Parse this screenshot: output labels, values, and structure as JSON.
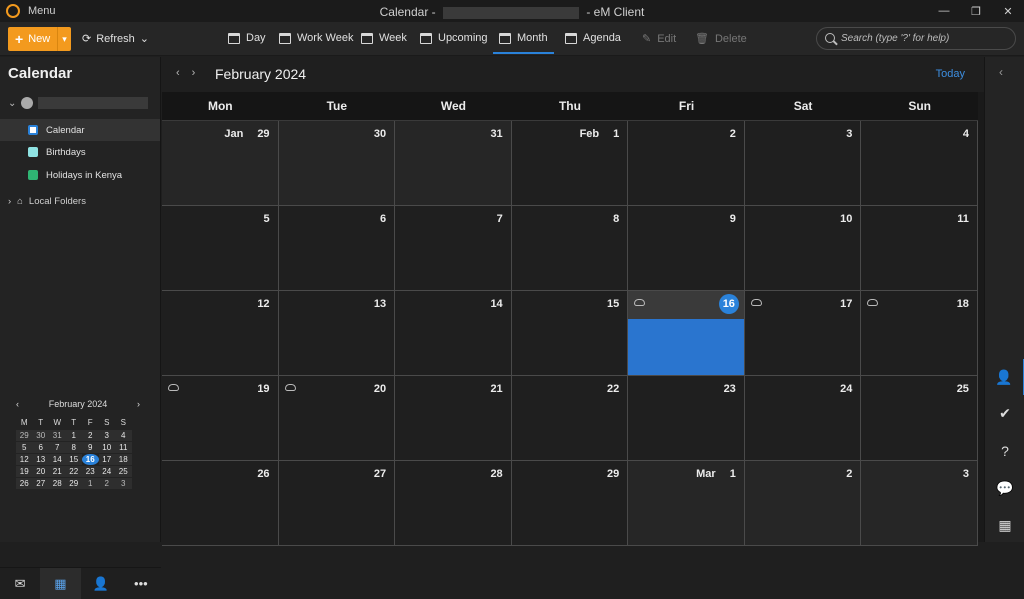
{
  "titlebar": {
    "menu_label": "Menu",
    "title_prefix": "Calendar -",
    "title_suffix": "- eM Client",
    "controls": [
      "—",
      "❐",
      "✕"
    ]
  },
  "toolbar": {
    "new_label": "New",
    "refresh_label": "Refresh",
    "views": [
      {
        "label": "Day"
      },
      {
        "label": "Work Week"
      },
      {
        "label": "Week"
      },
      {
        "label": "Upcoming"
      },
      {
        "label": "Month",
        "active": true
      },
      {
        "label": "Agenda"
      }
    ],
    "edit_label": "Edit",
    "delete_label": "Delete",
    "search_placeholder": "Search (type '?' for help)"
  },
  "sidebar": {
    "title": "Calendar",
    "calendars": [
      {
        "label": "Calendar",
        "color": "#ffffff",
        "selected": true
      },
      {
        "label": "Birthdays",
        "color": "#8fe3e3"
      },
      {
        "label": "Holidays in Kenya",
        "color": "#2fb573"
      }
    ],
    "local_folders_label": "Local Folders"
  },
  "mini_calendar": {
    "title": "February 2024",
    "day_headers": [
      "M",
      "T",
      "W",
      "T",
      "F",
      "S",
      "S"
    ],
    "days": [
      [
        "29",
        "30",
        "31",
        "1",
        "2",
        "3",
        "4"
      ],
      [
        "5",
        "6",
        "7",
        "8",
        "9",
        "10",
        "11"
      ],
      [
        "12",
        "13",
        "14",
        "15",
        "16",
        "17",
        "18"
      ],
      [
        "19",
        "20",
        "21",
        "22",
        "23",
        "24",
        "25"
      ],
      [
        "26",
        "27",
        "28",
        "29",
        "1",
        "2",
        "3"
      ]
    ],
    "today": "16"
  },
  "main": {
    "month_title": "February 2024",
    "today_label": "Today",
    "day_names": [
      "Mon",
      "Tue",
      "Wed",
      "Thu",
      "Fri",
      "Sat",
      "Sun"
    ],
    "weeks": [
      [
        {
          "d": "29",
          "m": "Jan",
          "other": true
        },
        {
          "d": "30",
          "other": true
        },
        {
          "d": "31",
          "other": true
        },
        {
          "d": "1",
          "m": "Feb"
        },
        {
          "d": "2"
        },
        {
          "d": "3"
        },
        {
          "d": "4"
        }
      ],
      [
        {
          "d": "5"
        },
        {
          "d": "6"
        },
        {
          "d": "7"
        },
        {
          "d": "8"
        },
        {
          "d": "9"
        },
        {
          "d": "10"
        },
        {
          "d": "11"
        }
      ],
      [
        {
          "d": "12"
        },
        {
          "d": "13"
        },
        {
          "d": "14"
        },
        {
          "d": "15"
        },
        {
          "d": "16",
          "today": true,
          "weather": true
        },
        {
          "d": "17",
          "weather": true
        },
        {
          "d": "18",
          "weather": true
        }
      ],
      [
        {
          "d": "19",
          "weather": true
        },
        {
          "d": "20",
          "weather": true
        },
        {
          "d": "21"
        },
        {
          "d": "22"
        },
        {
          "d": "23"
        },
        {
          "d": "24"
        },
        {
          "d": "25"
        }
      ],
      [
        {
          "d": "26"
        },
        {
          "d": "27"
        },
        {
          "d": "28"
        },
        {
          "d": "29"
        },
        {
          "d": "1",
          "m": "Mar",
          "other": true
        },
        {
          "d": "2",
          "other": true
        },
        {
          "d": "3",
          "other": true
        }
      ]
    ]
  },
  "bottom_nav": [
    {
      "icon": "mail-icon",
      "glyph": "✉"
    },
    {
      "icon": "calendar-icon",
      "glyph": "▦",
      "active": true
    },
    {
      "icon": "contacts-icon",
      "glyph": "👤"
    },
    {
      "icon": "more-icon",
      "glyph": "•••"
    }
  ],
  "right_rail": [
    {
      "icon": "contact-details-icon",
      "glyph": "👤",
      "active": true
    },
    {
      "icon": "tasks-icon",
      "glyph": "✔"
    },
    {
      "icon": "help-icon",
      "glyph": "?"
    },
    {
      "icon": "chat-icon",
      "glyph": "💬"
    },
    {
      "icon": "agenda-icon",
      "glyph": "▦"
    }
  ]
}
